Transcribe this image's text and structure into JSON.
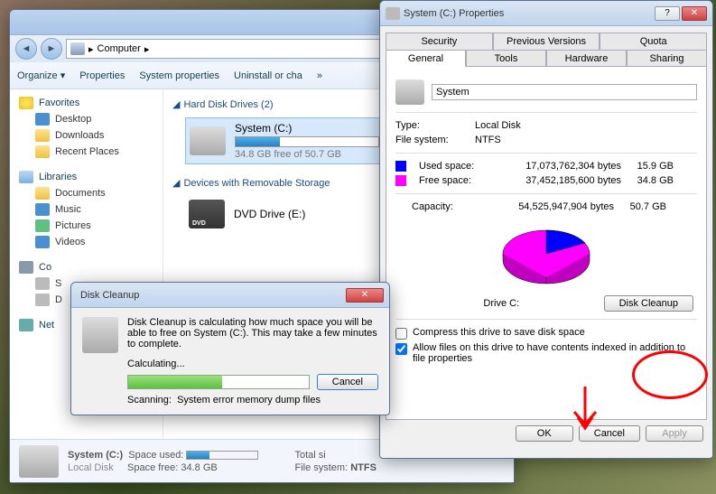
{
  "explorer": {
    "breadcrumb_root": "Computer",
    "breadcrumb_arrow": "▸",
    "toolbar": {
      "organize": "Organize ▾",
      "properties": "Properties",
      "system_properties": "System properties",
      "uninstall": "Uninstall or cha",
      "more": "»"
    },
    "sidebar": {
      "favorites": {
        "header": "Favorites",
        "items": [
          "Desktop",
          "Downloads",
          "Recent Places"
        ]
      },
      "libraries": {
        "header": "Libraries",
        "items": [
          "Documents",
          "Music",
          "Pictures",
          "Videos"
        ]
      },
      "computer": {
        "header": "Co",
        "items": [
          "S",
          "D"
        ]
      },
      "network": {
        "header": "Net"
      }
    },
    "sections": {
      "hdd": "Hard Disk Drives (2)",
      "removable": "Devices with Removable Storage"
    },
    "drive_c": {
      "name": "System (C:)",
      "free_text": "34.8 GB free of 50.7 GB",
      "fill_pct": 31
    },
    "drive_e": {
      "name": "DVD Drive (E:)"
    },
    "status": {
      "name": "System (C:)",
      "type_label": "Local Disk",
      "used_label": "Space used:",
      "free_label": "Space free:",
      "free_value": "34.8 GB",
      "total_label": "Total si",
      "fs_label": "File system:",
      "fs_value": "NTFS"
    }
  },
  "props": {
    "title": "System (C:) Properties",
    "tabs_row1": [
      "Security",
      "Previous Versions",
      "Quota"
    ],
    "tabs_row2": [
      "General",
      "Tools",
      "Hardware",
      "Sharing"
    ],
    "active_tab": "General",
    "volume_name": "System",
    "type_label": "Type:",
    "type_value": "Local Disk",
    "fs_label": "File system:",
    "fs_value": "NTFS",
    "used": {
      "label": "Used space:",
      "bytes": "17,073,762,304 bytes",
      "gb": "15.9 GB",
      "color": "#0000ff"
    },
    "free": {
      "label": "Free space:",
      "bytes": "37,452,185,600 bytes",
      "gb": "34.8 GB",
      "color": "#ff00ff"
    },
    "capacity": {
      "label": "Capacity:",
      "bytes": "54,525,947,904 bytes",
      "gb": "50.7 GB"
    },
    "drive_label": "Drive C:",
    "disk_cleanup_btn": "Disk Cleanup",
    "compress_label": "Compress this drive to save disk space",
    "index_label": "Allow files on this drive to have contents indexed in addition to file properties",
    "ok": "OK",
    "cancel": "Cancel",
    "apply": "Apply"
  },
  "cleanup": {
    "title": "Disk Cleanup",
    "message": "Disk Cleanup is calculating how much space you will be able to free on System (C:). This may take a few minutes to complete.",
    "calculating": "Calculating...",
    "cancel": "Cancel",
    "scanning_label": "Scanning:",
    "scanning_value": "System error memory dump files"
  },
  "chart_data": {
    "type": "pie",
    "title": "Drive C:",
    "series": [
      {
        "name": "Used space",
        "value": 17073762304,
        "gb": 15.9,
        "color": "#0000ff"
      },
      {
        "name": "Free space",
        "value": 37452185600,
        "gb": 34.8,
        "color": "#ff00ff"
      }
    ],
    "total": {
      "name": "Capacity",
      "value": 54525947904,
      "gb": 50.7
    }
  }
}
